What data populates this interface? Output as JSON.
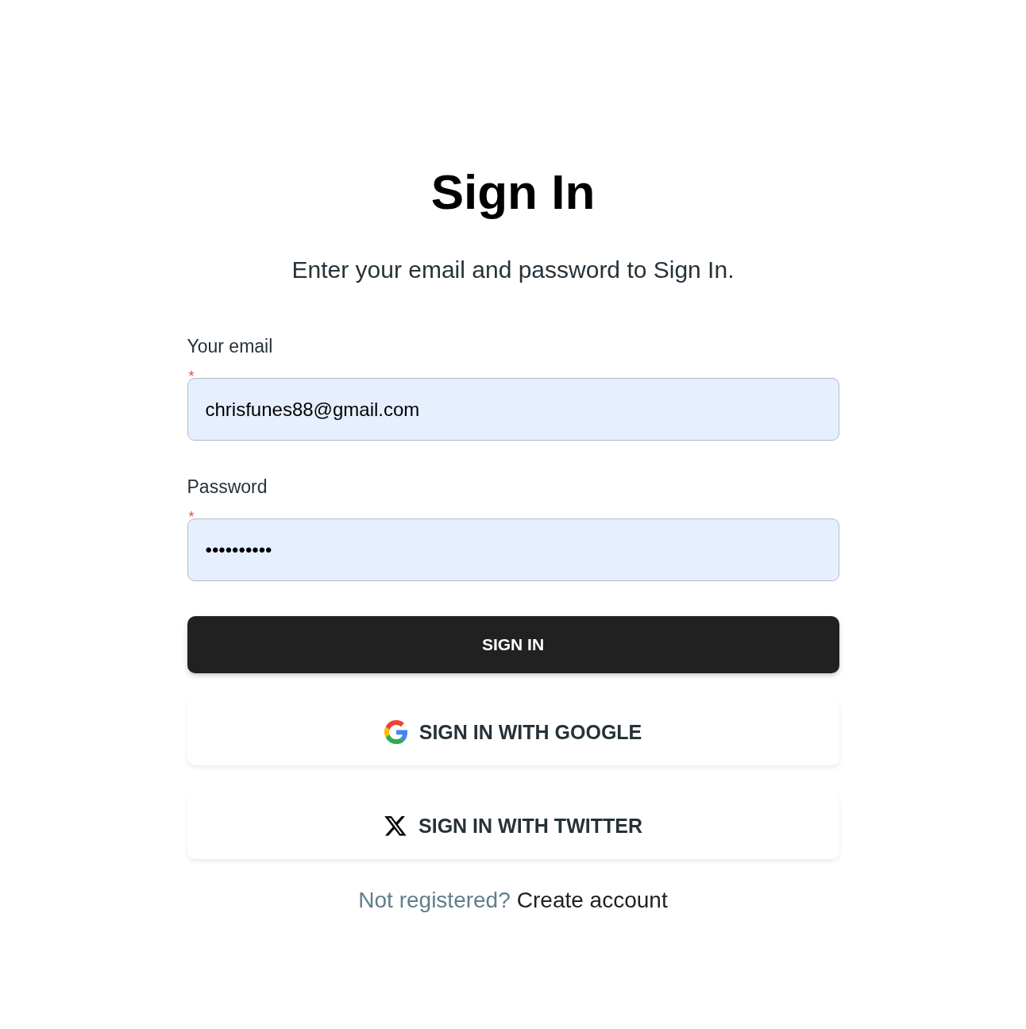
{
  "title": "Sign In",
  "subtitle": "Enter your email and password to Sign In.",
  "fields": [
    {
      "label": "Your email",
      "required_mark": "*",
      "value": "chrisfunes88@gmail.com"
    },
    {
      "label": "Password",
      "required_mark": "*",
      "value": "••••••••••"
    }
  ],
  "submit_button": "SIGN IN",
  "social_buttons": [
    {
      "kind": "google",
      "label": "SIGN IN WITH GOOGLE"
    },
    {
      "kind": "twitter",
      "label": "SIGN IN WITH TWITTER"
    }
  ],
  "footer": {
    "prompt": "Not registered?",
    "link": "Create account"
  }
}
